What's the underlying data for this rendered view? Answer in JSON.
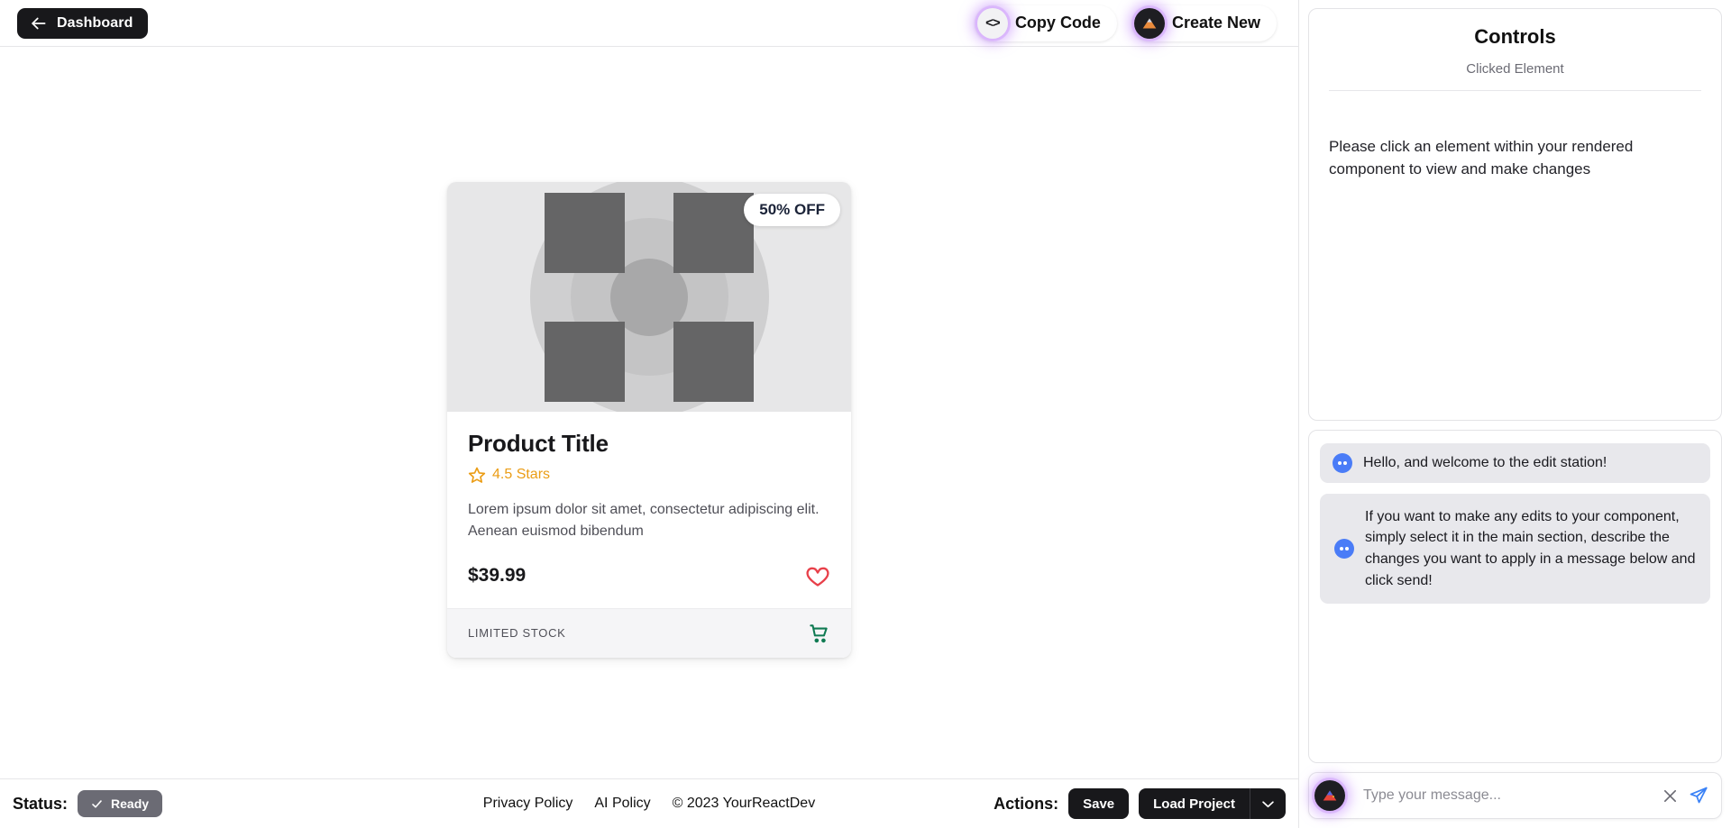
{
  "topbar": {
    "dashboard_label": "Dashboard",
    "back_icon": "arrow-left-icon",
    "copy_code_label": "Copy Code",
    "copy_code_icon": "code-brackets-icon",
    "create_new_label": "Create New",
    "create_new_icon": "mountain-logo-icon"
  },
  "card": {
    "badge": "50% OFF",
    "title": "Product Title",
    "rating_icon": "star-icon",
    "rating": "4.5 Stars",
    "description": "Lorem ipsum dolor sit amet, consectetur adipiscing elit. Aenean euismod bibendum",
    "price": "$39.99",
    "favorite_icon": "heart-icon",
    "stock": "LIMITED STOCK",
    "cart_icon": "shopping-cart-icon",
    "placeholder_icon": "image-placeholder-icon"
  },
  "statusbar": {
    "status_label": "Status:",
    "status_value": "Ready",
    "status_icon": "check-icon",
    "links": [
      {
        "label": "Privacy Policy"
      },
      {
        "label": "AI Policy"
      }
    ],
    "copyright": "© 2023 YourReactDev",
    "actions_label": "Actions:",
    "save_label": "Save",
    "load_project_label": "Load Project",
    "caret_icon": "chevron-down-icon"
  },
  "controls": {
    "title": "Controls",
    "subtitle": "Clicked Element",
    "hint": "Please click an element within your rendered component to view and make changes"
  },
  "chat": {
    "messages": [
      {
        "avatar_icon": "bot-avatar-icon",
        "text": "Hello, and welcome to the edit station!"
      },
      {
        "avatar_icon": "bot-avatar-icon",
        "text": "If you want to make any edits to your component, simply select it in the main section, describe the changes you want to apply in a message below and click send!"
      }
    ],
    "composer": {
      "avatar_icon": "mountain-logo-icon",
      "placeholder": "Type your message...",
      "value": "",
      "clear_icon": "close-x-icon",
      "send_icon": "send-paper-plane-icon"
    }
  },
  "colors": {
    "accent_purple": "#c084fc",
    "dark": "#18181b",
    "star_orange": "#eb9d16",
    "heart_red": "#e8404a",
    "cart_green": "#0f7a52",
    "bot_blue": "#4a7cf7",
    "send_blue": "#3b82f6"
  }
}
